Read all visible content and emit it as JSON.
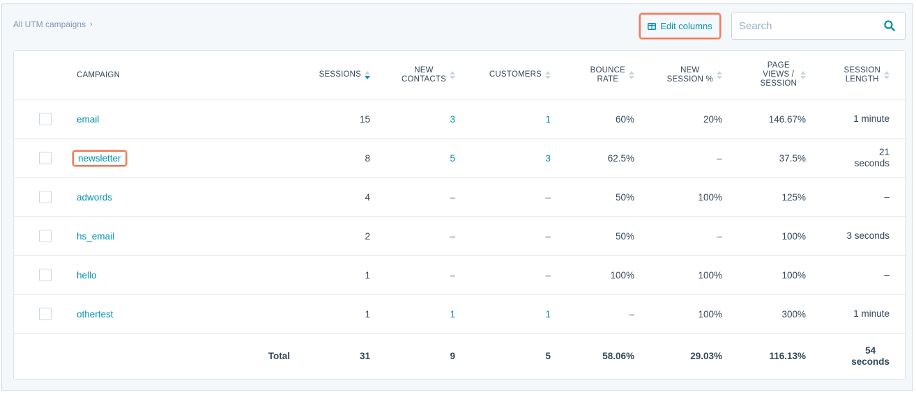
{
  "breadcrumb": {
    "label": "All UTM campaigns",
    "chevron": "›"
  },
  "toolbar": {
    "edit_columns_label": "Edit columns",
    "edit_columns_icon": "columns-icon"
  },
  "search": {
    "placeholder": "Search",
    "value": "",
    "icon": "search-icon"
  },
  "colors": {
    "accent": "#0091ae",
    "highlight": "#f2795a",
    "text": "#33475b",
    "border": "#dfe3eb"
  },
  "table": {
    "columns": {
      "campaign": "CAMPAIGN",
      "sessions": "SESSIONS",
      "new_contacts": [
        "NEW",
        "CONTACTS"
      ],
      "customers": "CUSTOMERS",
      "bounce_rate": [
        "BOUNCE",
        "RATE"
      ],
      "new_session_pct": [
        "NEW",
        "SESSION %"
      ],
      "page_views": [
        "PAGE",
        "VIEWS /",
        "SESSION"
      ],
      "session_length": [
        "SESSION",
        "LENGTH"
      ]
    },
    "sorted_column": "sessions",
    "rows": [
      {
        "campaign": "email",
        "sessions": "15",
        "new_contacts": "3",
        "customers": "1",
        "bounce_rate": "60%",
        "new_session_pct": "20%",
        "page_views": "146.67%",
        "session_length": [
          "1 minute"
        ]
      },
      {
        "campaign": "newsletter",
        "sessions": "8",
        "new_contacts": "5",
        "customers": "3",
        "bounce_rate": "62.5%",
        "new_session_pct": "–",
        "page_views": "37.5%",
        "session_length": [
          "21",
          "seconds"
        ]
      },
      {
        "campaign": "adwords",
        "sessions": "4",
        "new_contacts": "–",
        "customers": "–",
        "bounce_rate": "50%",
        "new_session_pct": "100%",
        "page_views": "125%",
        "session_length": [
          "–"
        ]
      },
      {
        "campaign": "hs_email",
        "sessions": "2",
        "new_contacts": "–",
        "customers": "–",
        "bounce_rate": "50%",
        "new_session_pct": "–",
        "page_views": "100%",
        "session_length": [
          "3 seconds"
        ]
      },
      {
        "campaign": "hello",
        "sessions": "1",
        "new_contacts": "–",
        "customers": "–",
        "bounce_rate": "100%",
        "new_session_pct": "100%",
        "page_views": "100%",
        "session_length": [
          "–"
        ]
      },
      {
        "campaign": "othertest",
        "sessions": "1",
        "new_contacts": "1",
        "customers": "1",
        "bounce_rate": "–",
        "new_session_pct": "100%",
        "page_views": "300%",
        "session_length": [
          "1 minute"
        ]
      }
    ],
    "total": {
      "label": "Total",
      "sessions": "31",
      "new_contacts": "9",
      "customers": "5",
      "bounce_rate": "58.06%",
      "new_session_pct": "29.03%",
      "page_views": "116.13%",
      "session_length": [
        "54",
        "seconds"
      ]
    }
  }
}
